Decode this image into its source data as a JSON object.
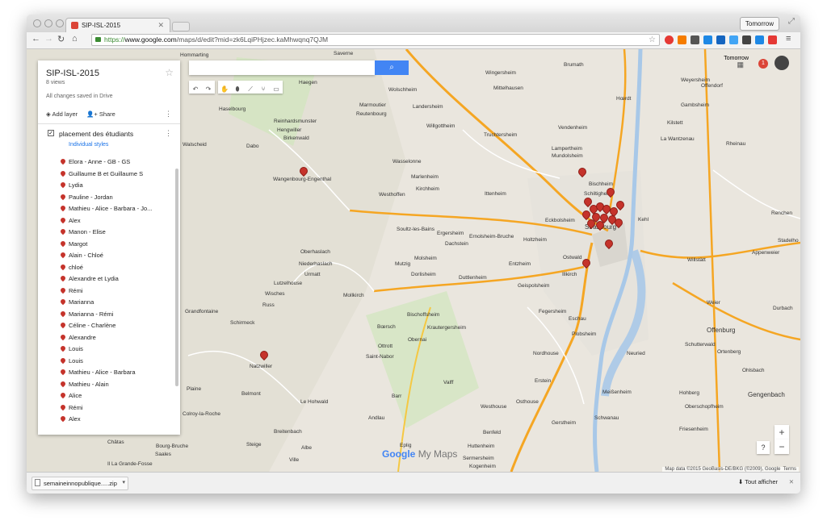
{
  "browser": {
    "tab_title": "SIP-ISL-2015",
    "profile_label": "Tomorrow",
    "url_scheme": "https://",
    "url_host": "www.google.com",
    "url_path": "/maps/d/edit?mid=zk6LqiPHjzec.kaMhwqnq7QJM"
  },
  "panel": {
    "title": "SIP-ISL-2015",
    "views": "8 views",
    "saved_status": "All changes saved in Drive",
    "add_layer": "Add layer",
    "share": "Share",
    "layer_name": "placement des étudiants",
    "styles_link": "Individual styles",
    "items": [
      "Elora - Anne - GB - GS",
      "Guillaume B et Guillaume S",
      "Lydia",
      "Pauline - Jordan",
      "Mathieu - Alice - Barbara - Jo...",
      "Alex",
      "Manon - Elise",
      "Margot",
      "Alain - Chloé",
      "chloé",
      "Alexandre et Lydia",
      "Rémi",
      "Marianna",
      "Marianna - Rémi",
      "Céline - Charlène",
      "Alexandre",
      "Louis",
      "Louis",
      "Mathieu - Alice - Barbara",
      "Mathieu - Alain",
      "Alice",
      "Rémi",
      "Alex"
    ]
  },
  "map": {
    "top_right_label": "Tomorrow",
    "notification_count": "1",
    "logo_google": "Google",
    "logo_my_maps": "My Maps",
    "attribution": "Map data ©2015 GeoBasis-DE/BKG (©2009), Google",
    "terms": "Terms",
    "zoom_in": "+",
    "zoom_out": "−",
    "help": "?",
    "places": [
      "Hommarting",
      "Saverne",
      "Brumath",
      "Weyersheim",
      "Haegen",
      "Wolschheim",
      "Wingersheim",
      "Mittelhausen",
      "Offendorf",
      "Haselbourg",
      "Reinhardsmunster",
      "Marmoutier",
      "Landersheim",
      "Hœrdt",
      "Gambsheim",
      "Kilstett",
      "Hengwiller",
      "Reutenbourg",
      "Willgottheim",
      "Truchtersheim",
      "Vendenheim",
      "Birkenwald",
      "La Wantzenau",
      "Rheinau",
      "Walscheid",
      "Dabo",
      "Lampertheim",
      "Mundolsheim",
      "Wasselonne",
      "Wangenbourg-Engenthal",
      "Marlenheim",
      "Kirchheim",
      "Westhoffen",
      "Bischheim",
      "Schiltigheim",
      "Ittenheim",
      "Eckbolsheim",
      "Kehl",
      "Renchen",
      "Soultz-les-Bains",
      "Ergersheim",
      "Holtzheim",
      "Dachstein",
      "Ernolsheim-Bruche",
      "Strasbourg",
      "Stadelho",
      "Oberhaslach",
      "Molsheim",
      "Ostwald",
      "Willstätt",
      "Appenweier",
      "Niederhaslach",
      "Mutzig",
      "Entzheim",
      "Urmatt",
      "Dorlisheim",
      "Duttlenheim",
      "Illkirch",
      "Lutzelhouse",
      "Geispolsheim",
      "Wisches",
      "Mollkirch",
      "Russ",
      "Fegersheim",
      "Eschau",
      "Bischoffsheim",
      "Grandfontaine",
      "Weier",
      "Durbach",
      "Schirmeck",
      "Bœrsch",
      "Krautergersheim",
      "Plobsheim",
      "Offenburg",
      "Ottrott",
      "Obernai",
      "Saint-Nabor",
      "Nordhouse",
      "Neuried",
      "Schutterwald",
      "Ortenberg",
      "Natzwiller",
      "Erstein",
      "Ohlsbach",
      "Plaine",
      "Belmont",
      "Barr",
      "Meißenheim",
      "Hohberg",
      "Gengenbach",
      "Le Hohwald",
      "Valff",
      "Osthouse",
      "Oberschopfheim",
      "Colroy-la-Roche",
      "Andlau",
      "Westhouse",
      "Gerstheim",
      "Schwanau",
      "Friesenheim",
      "Breitenbach",
      "Benfeld",
      "Steige",
      "Albe",
      "Eplig",
      "Huttenheim",
      "Bourg-Bruche",
      "Châtas",
      "Saales",
      "Ville",
      "Sermersheim",
      "Kogenheim",
      "Il La Grande-Fosse"
    ]
  },
  "downloads": {
    "filename": "semaineinnopublique.....zip",
    "show_all": "Tout afficher"
  },
  "colors": {
    "marker": "#c5332b",
    "accent": "#4285f4",
    "road_major": "#f5a623",
    "water": "#a8c8e8"
  }
}
